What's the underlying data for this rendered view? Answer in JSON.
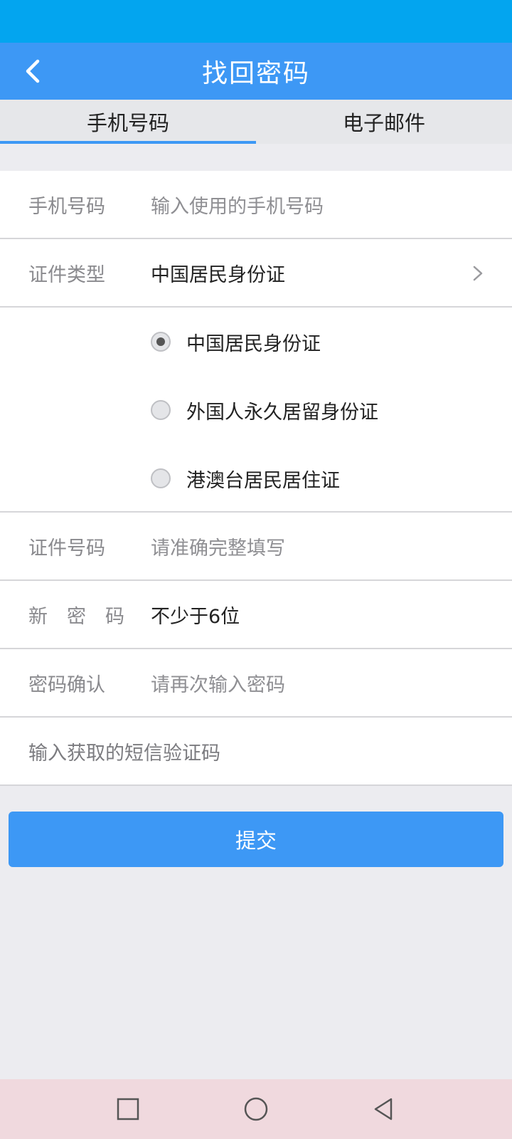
{
  "app_bar": {
    "title": "找回密码",
    "back_icon": "chevron-left-icon"
  },
  "tabs": [
    {
      "label": "手机号码",
      "active": true
    },
    {
      "label": "电子邮件",
      "active": false
    }
  ],
  "form": {
    "phone": {
      "label": "手机号码",
      "placeholder": "输入使用的手机号码"
    },
    "id_type": {
      "label": "证件类型",
      "value": "中国居民身份证",
      "options": [
        {
          "label": "中国居民身份证",
          "selected": true
        },
        {
          "label": "外国人永久居留身份证",
          "selected": false
        },
        {
          "label": "港澳台居民居住证",
          "selected": false
        }
      ]
    },
    "id_number": {
      "label": "证件号码",
      "placeholder": "请准确完整填写"
    },
    "new_password": {
      "label": "新　密　码",
      "placeholder": "不少于6位"
    },
    "confirm_password": {
      "label": "密码确认",
      "placeholder": "请再次输入密码"
    },
    "sms_code": {
      "placeholder": "输入获取的短信验证码"
    }
  },
  "submit_label": "提交",
  "colors": {
    "accent": "#3d98f5",
    "status_bar": "#03a5ef"
  }
}
